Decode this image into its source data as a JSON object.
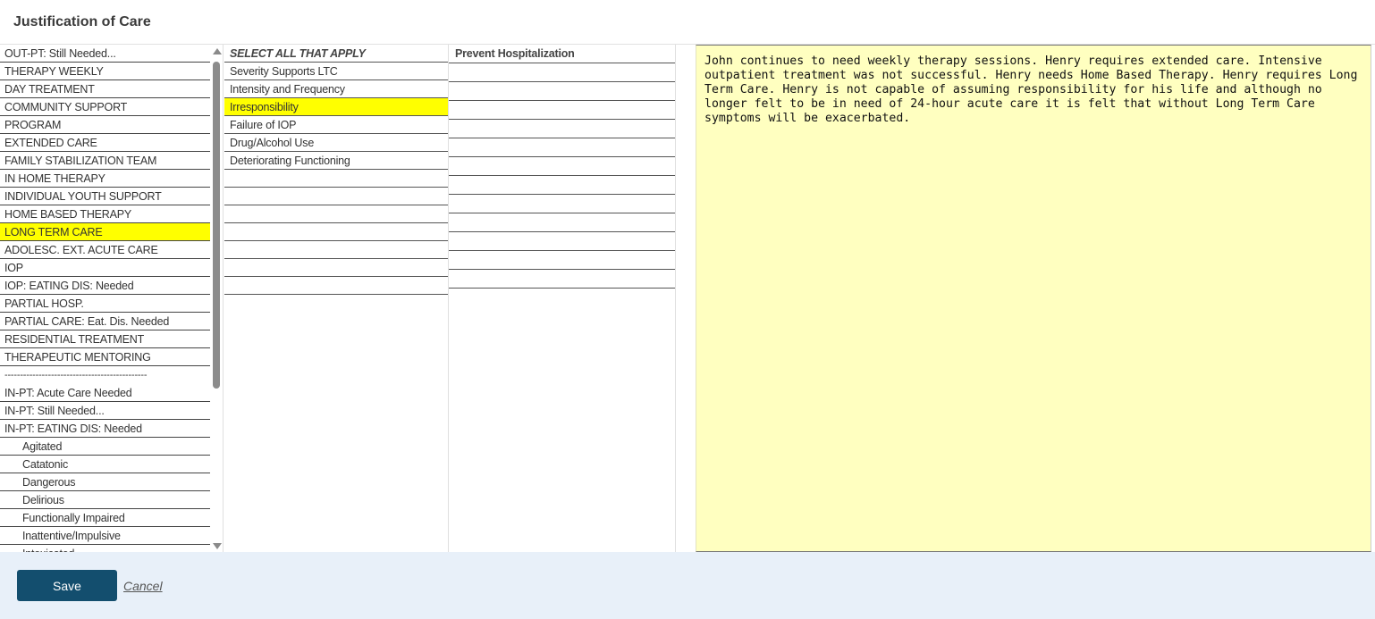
{
  "title": "Justification of Care",
  "care_types": [
    {
      "label": "OUT-PT: Still Needed...",
      "selected": false,
      "indent": false
    },
    {
      "label": "THERAPY WEEKLY",
      "selected": false,
      "indent": false
    },
    {
      "label": "DAY TREATMENT",
      "selected": false,
      "indent": false
    },
    {
      "label": "COMMUNITY SUPPORT",
      "selected": false,
      "indent": false
    },
    {
      "label": "PROGRAM",
      "selected": false,
      "indent": false
    },
    {
      "label": "EXTENDED CARE",
      "selected": false,
      "indent": false
    },
    {
      "label": "FAMILY STABILIZATION TEAM",
      "selected": false,
      "indent": false
    },
    {
      "label": "IN HOME THERAPY",
      "selected": false,
      "indent": false
    },
    {
      "label": "INDIVIDUAL YOUTH SUPPORT",
      "selected": false,
      "indent": false
    },
    {
      "label": "HOME BASED THERAPY",
      "selected": false,
      "indent": false
    },
    {
      "label": "LONG TERM CARE",
      "selected": true,
      "indent": false
    },
    {
      "label": "ADOLESC. EXT. ACUTE CARE",
      "selected": false,
      "indent": false
    },
    {
      "label": "IOP",
      "selected": false,
      "indent": false
    },
    {
      "label": "IOP: EATING DIS: Needed",
      "selected": false,
      "indent": false
    },
    {
      "label": "PARTIAL HOSP.",
      "selected": false,
      "indent": false
    },
    {
      "label": "PARTIAL CARE: Eat. Dis. Needed",
      "selected": false,
      "indent": false
    },
    {
      "label": "RESIDENTIAL TREATMENT",
      "selected": false,
      "indent": false
    },
    {
      "label": "THERAPEUTIC MENTORING",
      "selected": false,
      "indent": false
    },
    {
      "label": "----------------------------------------------",
      "selected": false,
      "indent": false,
      "separator": true
    },
    {
      "label": "IN-PT: Acute Care Needed",
      "selected": false,
      "indent": false
    },
    {
      "label": "IN-PT: Still Needed...",
      "selected": false,
      "indent": false
    },
    {
      "label": "IN-PT: EATING DIS: Needed",
      "selected": false,
      "indent": false
    },
    {
      "label": "Agitated",
      "selected": false,
      "indent": true
    },
    {
      "label": "Catatonic",
      "selected": false,
      "indent": true
    },
    {
      "label": "Dangerous",
      "selected": false,
      "indent": true
    },
    {
      "label": "Delirious",
      "selected": false,
      "indent": true
    },
    {
      "label": "Functionally Impaired",
      "selected": false,
      "indent": true
    },
    {
      "label": "Inattentive/Impulsive",
      "selected": false,
      "indent": true
    },
    {
      "label": "Intoxicated",
      "selected": false,
      "indent": true
    }
  ],
  "criteria": [
    {
      "label": "SELECT ALL THAT APPLY",
      "header": true,
      "selected": false
    },
    {
      "label": "Severity Supports LTC",
      "header": false,
      "selected": false
    },
    {
      "label": "Intensity and Frequency",
      "header": false,
      "selected": false
    },
    {
      "label": "Irresponsibility",
      "header": false,
      "selected": true
    },
    {
      "label": "Failure of IOP",
      "header": false,
      "selected": false
    },
    {
      "label": "Drug/Alcohol Use",
      "header": false,
      "selected": false
    },
    {
      "label": "Deteriorating Functioning",
      "header": false,
      "selected": false
    },
    {
      "label": "",
      "header": false,
      "selected": false
    },
    {
      "label": "",
      "header": false,
      "selected": false
    },
    {
      "label": "",
      "header": false,
      "selected": false
    },
    {
      "label": "",
      "header": false,
      "selected": false
    },
    {
      "label": "",
      "header": false,
      "selected": false
    },
    {
      "label": "",
      "header": false,
      "selected": false
    },
    {
      "label": "",
      "header": false,
      "selected": false
    }
  ],
  "sub_criteria": [
    {
      "label": "Prevent Hospitalization",
      "header": true
    },
    {
      "label": "",
      "header": false
    },
    {
      "label": "",
      "header": false
    },
    {
      "label": "",
      "header": false
    },
    {
      "label": "",
      "header": false
    },
    {
      "label": "",
      "header": false
    },
    {
      "label": "",
      "header": false
    },
    {
      "label": "",
      "header": false
    },
    {
      "label": "",
      "header": false
    },
    {
      "label": "",
      "header": false
    },
    {
      "label": "",
      "header": false
    },
    {
      "label": "",
      "header": false
    },
    {
      "label": "",
      "header": false
    }
  ],
  "notes_text": "John continues to need weekly therapy sessions. Henry requires extended care. Intensive outpatient treatment was not successful. Henry needs Home Based Therapy. Henry requires Long Term Care. Henry is not capable of assuming responsibility for his life and although no longer felt to be in need of 24-hour acute care it is felt that without Long Term Care symptoms will be exacerbated. ",
  "footer": {
    "save_label": "Save",
    "cancel_label": "Cancel"
  },
  "colors": {
    "highlight": "#ffff00",
    "notes_bg": "#ffffc0",
    "save_bg": "#134e6e",
    "footer_bg": "#e8f0f9"
  }
}
